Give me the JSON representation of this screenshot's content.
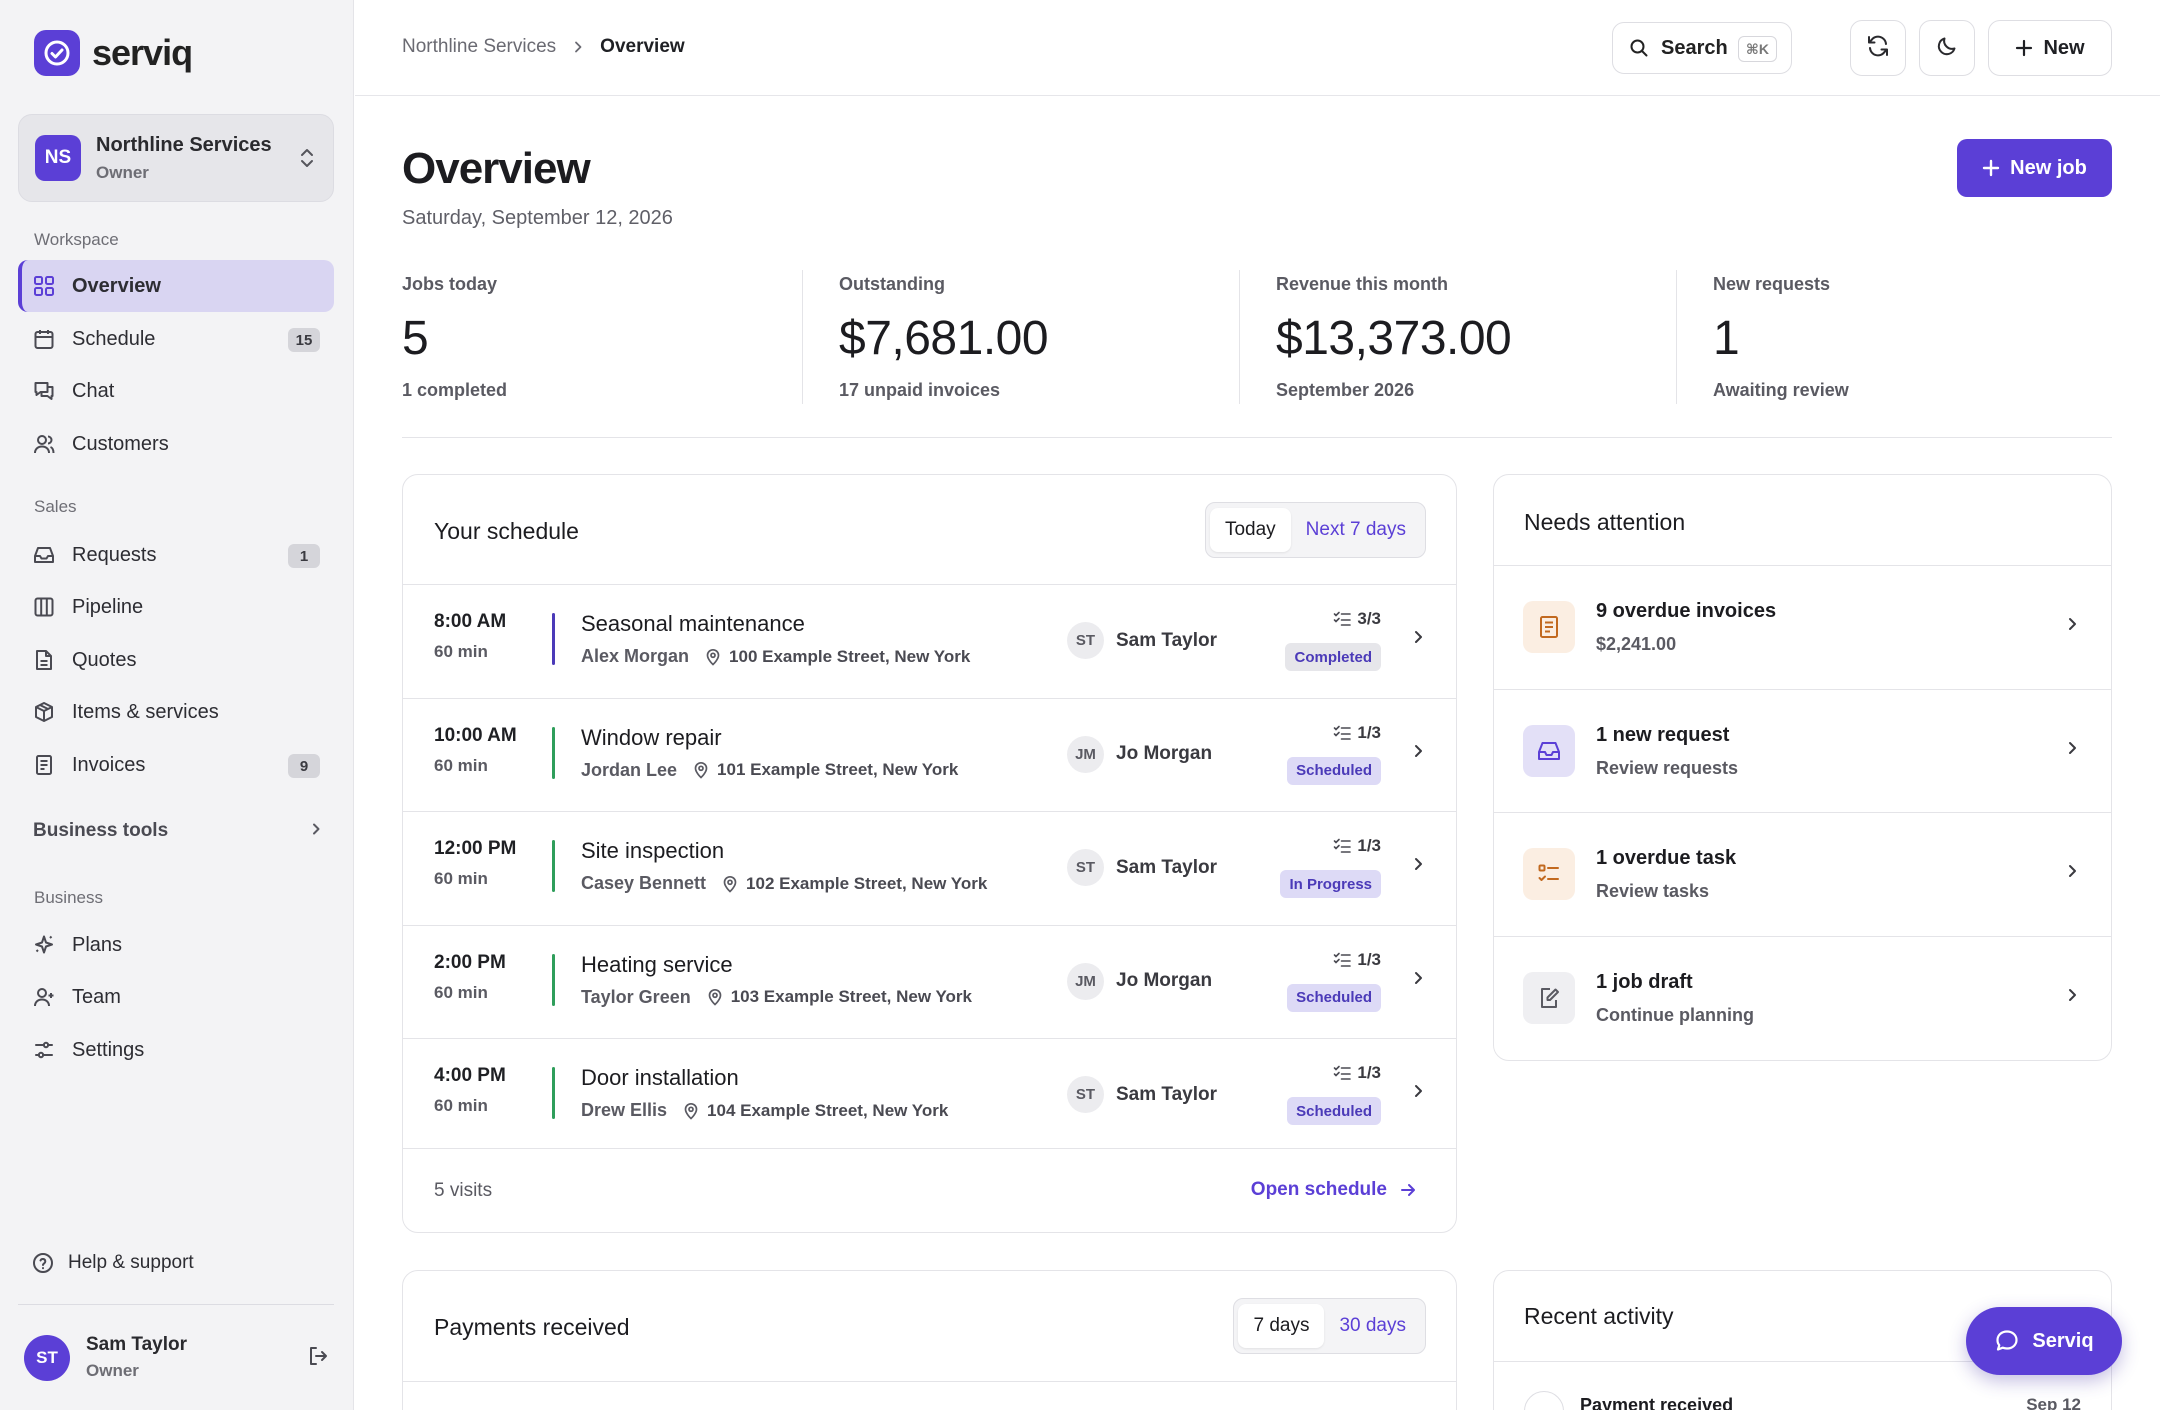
{
  "brand": {
    "name": "serviq",
    "color": "#5b3fd6"
  },
  "org": {
    "initials": "NS",
    "name": "Northline Services",
    "role": "Owner"
  },
  "sidebar": {
    "sections": {
      "workspace": "Workspace",
      "sales": "Sales",
      "business": "Business"
    },
    "workspace": [
      {
        "label": "Overview",
        "icon": "grid-icon",
        "active": true
      },
      {
        "label": "Schedule",
        "icon": "calendar-icon",
        "badge": "15"
      },
      {
        "label": "Chat",
        "icon": "chat-icon"
      },
      {
        "label": "Customers",
        "icon": "users-icon"
      }
    ],
    "sales": [
      {
        "label": "Requests",
        "icon": "inbox-icon",
        "badge": "1"
      },
      {
        "label": "Pipeline",
        "icon": "columns-icon"
      },
      {
        "label": "Quotes",
        "icon": "document-icon"
      },
      {
        "label": "Items & services",
        "icon": "box-icon"
      },
      {
        "label": "Invoices",
        "icon": "invoice-icon",
        "badge": "9"
      }
    ],
    "business_tools": "Business tools",
    "business": [
      {
        "label": "Plans",
        "icon": "sparkle-icon"
      },
      {
        "label": "Team",
        "icon": "team-icon"
      },
      {
        "label": "Settings",
        "icon": "sliders-icon"
      }
    ],
    "help": "Help & support",
    "user": {
      "initials": "ST",
      "name": "Sam Taylor",
      "role": "Owner"
    }
  },
  "topbar": {
    "breadcrumb": [
      "Northline Services",
      "Overview"
    ],
    "search_label": "Search",
    "search_shortcut": "⌘K",
    "new_label": "New"
  },
  "page": {
    "title": "Overview",
    "date": "Saturday, September 12, 2026",
    "new_job": "New job"
  },
  "stats": [
    {
      "label": "Jobs today",
      "value": "5",
      "sub": "1 completed"
    },
    {
      "label": "Outstanding",
      "value": "$7,681.00",
      "sub": "17 unpaid invoices"
    },
    {
      "label": "Revenue this month",
      "value": "$13,373.00",
      "sub": "September 2026"
    },
    {
      "label": "New requests",
      "value": "1",
      "sub": "Awaiting review"
    }
  ],
  "schedule": {
    "title": "Your schedule",
    "tabs": [
      "Today",
      "Next 7 days"
    ],
    "rows": [
      {
        "time": "8:00 AM",
        "duration": "60 min",
        "title": "Seasonal maintenance",
        "customer": "Alex Morgan",
        "address": "100 Example Street, New York",
        "assignee_initials": "ST",
        "assignee": "Sam Taylor",
        "tasks": "3/3",
        "status": "Completed",
        "status_class": "completed",
        "bar_color": "#4b3ab8"
      },
      {
        "time": "10:00 AM",
        "duration": "60 min",
        "title": "Window repair",
        "customer": "Jordan Lee",
        "address": "101 Example Street, New York",
        "assignee_initials": "JM",
        "assignee": "Jo Morgan",
        "tasks": "1/3",
        "status": "Scheduled",
        "status_class": "scheduled",
        "bar_color": "#2f9e5b"
      },
      {
        "time": "12:00 PM",
        "duration": "60 min",
        "title": "Site inspection",
        "customer": "Casey Bennett",
        "address": "102 Example Street, New York",
        "assignee_initials": "ST",
        "assignee": "Sam Taylor",
        "tasks": "1/3",
        "status": "In Progress",
        "status_class": "progress",
        "bar_color": "#2f9e5b"
      },
      {
        "time": "2:00 PM",
        "duration": "60 min",
        "title": "Heating service",
        "customer": "Taylor Green",
        "address": "103 Example Street, New York",
        "assignee_initials": "JM",
        "assignee": "Jo Morgan",
        "tasks": "1/3",
        "status": "Scheduled",
        "status_class": "scheduled",
        "bar_color": "#2f9e5b"
      },
      {
        "time": "4:00 PM",
        "duration": "60 min",
        "title": "Door installation",
        "customer": "Drew Ellis",
        "address": "104 Example Street, New York",
        "assignee_initials": "ST",
        "assignee": "Sam Taylor",
        "tasks": "1/3",
        "status": "Scheduled",
        "status_class": "scheduled",
        "bar_color": "#2f9e5b"
      }
    ],
    "footer_count": "5 visits",
    "footer_link": "Open schedule"
  },
  "attention": {
    "title": "Needs attention",
    "items": [
      {
        "title": "9 overdue invoices",
        "sub": "$2,241.00",
        "icon": "invoice-icon",
        "tint": "#fbeee2",
        "color": "#c2691f"
      },
      {
        "title": "1 new request",
        "sub": "Review requests",
        "icon": "inbox-icon",
        "tint": "#e3e0f7",
        "color": "#5b3fd6"
      },
      {
        "title": "1 overdue task",
        "sub": "Review tasks",
        "icon": "checklist-icon",
        "tint": "#fbeee2",
        "color": "#c2691f"
      },
      {
        "title": "1 job draft",
        "sub": "Continue planning",
        "icon": "edit-icon",
        "tint": "#efeff2",
        "color": "#5a5a62"
      }
    ]
  },
  "payments": {
    "title": "Payments received",
    "tabs": [
      "7 days",
      "30 days"
    ]
  },
  "activity": {
    "title": "Recent activity",
    "first_item": "Payment received",
    "first_date": "Sep 12"
  },
  "chat_fab": "Serviq"
}
